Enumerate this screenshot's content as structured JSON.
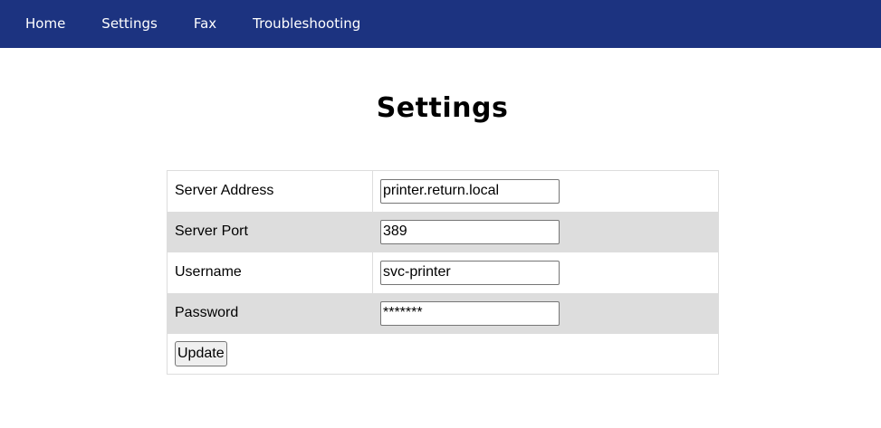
{
  "nav": {
    "items": [
      {
        "label": "Home"
      },
      {
        "label": "Settings"
      },
      {
        "label": "Fax"
      },
      {
        "label": "Troubleshooting"
      }
    ]
  },
  "page": {
    "title": "Settings"
  },
  "form": {
    "rows": [
      {
        "label": "Server Address",
        "value": "printer.return.local",
        "type": "text"
      },
      {
        "label": "Server Port",
        "value": "389",
        "type": "text"
      },
      {
        "label": "Username",
        "value": "svc-printer",
        "type": "text"
      },
      {
        "label": "Password",
        "value": "*******",
        "type": "password"
      }
    ],
    "submit_label": "Update"
  },
  "colors": {
    "navbar": "#1c3380",
    "row_shade": "#dddddd"
  }
}
